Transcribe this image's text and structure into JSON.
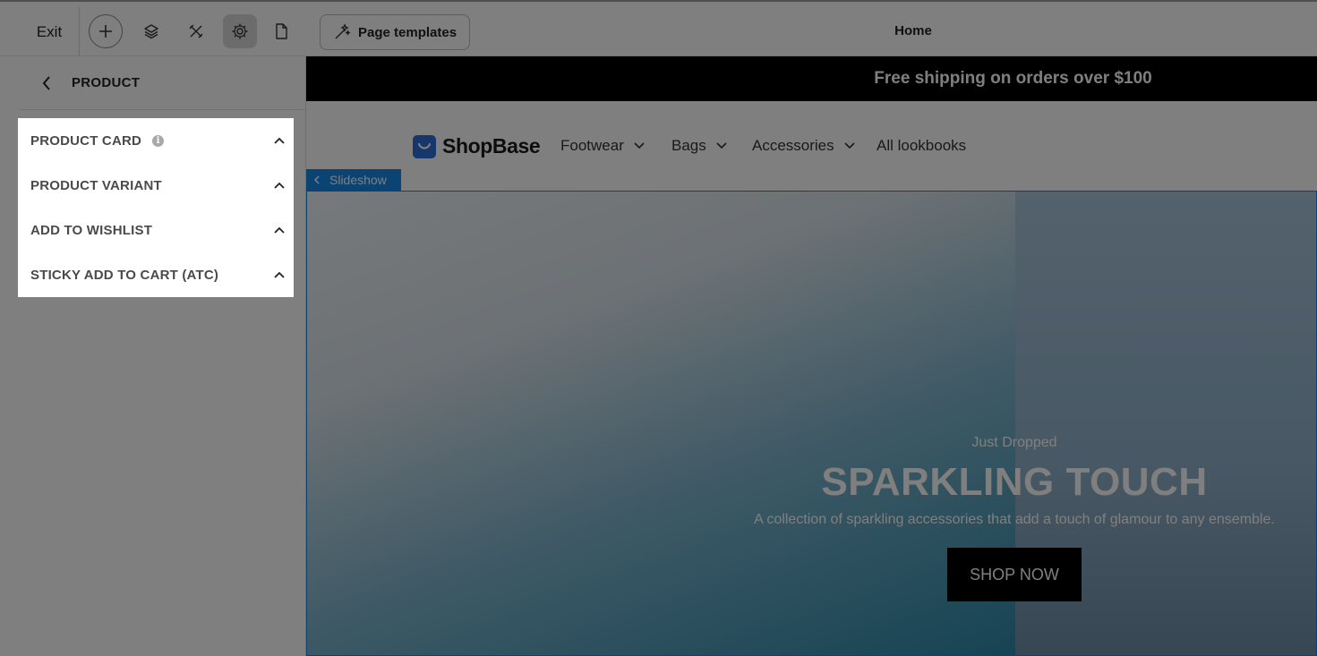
{
  "toolbar": {
    "exit_label": "Exit",
    "icons": [
      "plus-icon",
      "layers-icon",
      "design-icon",
      "gear-icon",
      "page-icon"
    ],
    "page_templates_label": "Page templates",
    "current_page": "Home"
  },
  "sidebar": {
    "title": "PRODUCT",
    "items": [
      {
        "label": "PRODUCT CARD",
        "has_info": true
      },
      {
        "label": "PRODUCT VARIANT"
      },
      {
        "label": "ADD TO WISHLIST"
      },
      {
        "label": "STICKY ADD TO CART (ATC)"
      }
    ]
  },
  "canvas": {
    "announcement": "Free shipping on orders over $100",
    "logo_text": "ShopBase",
    "nav": [
      {
        "label": "Footwear",
        "has_dropdown": true
      },
      {
        "label": "Bags",
        "has_dropdown": true
      },
      {
        "label": "Accessories",
        "has_dropdown": true
      },
      {
        "label": "All lookbooks",
        "has_dropdown": false
      }
    ],
    "section_tag": "Slideshow",
    "hero": {
      "kicker": "Just Dropped",
      "title": "SPARKLING TOUCH",
      "subtitle": "A collection of sparkling accessories that add a touch of glamour to any ensemble.",
      "button": "SHOP NOW"
    }
  },
  "colors": {
    "accent": "#1787e6",
    "brand": "#2c6cd9",
    "announcement_bg": "#000000"
  }
}
